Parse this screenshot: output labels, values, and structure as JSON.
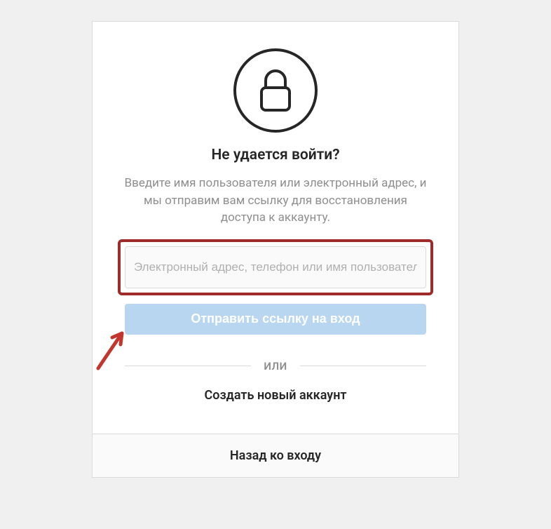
{
  "icons": {
    "lock": "lock-icon"
  },
  "title": "Не удается войти?",
  "description": "Введите имя пользователя или электронный адрес, и мы отправим вам ссылку для восстановления доступа к аккаунту.",
  "input": {
    "placeholder": "Электронный адрес, телефон или имя пользователя",
    "value": ""
  },
  "send_button_label": "Отправить ссылку на вход",
  "divider_text": "ИЛИ",
  "create_account_label": "Создать новый аккаунт",
  "back_link_label": "Назад ко входу",
  "annotations": {
    "arrow": "arrow-annotation",
    "highlight": "input-highlight"
  },
  "colors": {
    "button_bg": "#b8d6f0",
    "highlight_border": "#9e2a2a",
    "arrow": "#c2362e",
    "text_muted": "#8e8e8e"
  }
}
